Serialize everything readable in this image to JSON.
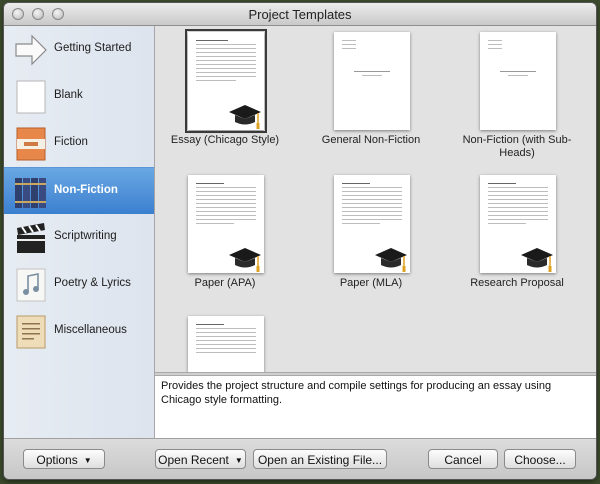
{
  "window": {
    "title": "Project Templates"
  },
  "sidebar": {
    "items": [
      {
        "label": "Getting Started",
        "icon": "arrow-icon"
      },
      {
        "label": "Blank",
        "icon": "blank-page-icon"
      },
      {
        "label": "Fiction",
        "icon": "book-icon"
      },
      {
        "label": "Non-Fiction",
        "icon": "books-icon",
        "selected": true
      },
      {
        "label": "Scriptwriting",
        "icon": "clapperboard-icon"
      },
      {
        "label": "Poetry & Lyrics",
        "icon": "music-note-icon"
      },
      {
        "label": "Miscellaneous",
        "icon": "parchment-icon"
      }
    ]
  },
  "templates": [
    {
      "label": "Essay (Chicago Style)",
      "selected": true,
      "cap": true
    },
    {
      "label": "General Non-Fiction",
      "cap": false
    },
    {
      "label": "Non-Fiction (with Sub-Heads)",
      "cap": false
    },
    {
      "label": "Paper (APA)",
      "cap": true
    },
    {
      "label": "Paper (MLA)",
      "cap": true
    },
    {
      "label": "Research Proposal",
      "cap": true
    },
    {
      "label": "",
      "cap": false
    }
  ],
  "description": "Provides the project structure and compile settings for producing an essay using Chicago style formatting.",
  "footer": {
    "options": "Options",
    "open_recent": "Open Recent",
    "open_existing": "Open an Existing File...",
    "cancel": "Cancel",
    "choose": "Choose..."
  },
  "colors": {
    "selection": "#3b7fcf",
    "pane": "#e2e2e2"
  }
}
